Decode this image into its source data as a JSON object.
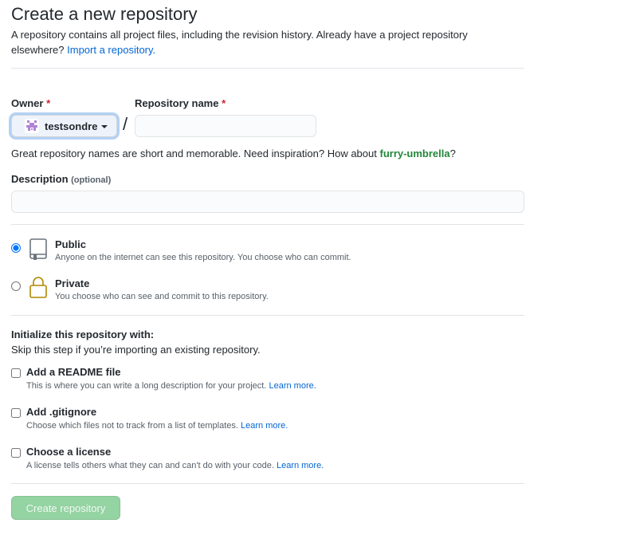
{
  "header": {
    "title": "Create a new repository",
    "subhead_text": "A repository contains all project files, including the revision history. Already have a project repository elsewhere?",
    "import_link": "Import a repository."
  },
  "owner": {
    "label": "Owner",
    "required_mark": "*",
    "selected": "testsondre"
  },
  "repo_name": {
    "label": "Repository name",
    "required_mark": "*",
    "value": "",
    "placeholder": "",
    "separator": "/"
  },
  "hint": {
    "prefix": "Great repository names are short and memorable. Need inspiration? How about",
    "suggestion": "furry-umbrella",
    "suffix": "?"
  },
  "description": {
    "label": "Description",
    "optional": "(optional)",
    "value": ""
  },
  "visibility": {
    "selected": "public",
    "options": [
      {
        "id": "public",
        "title": "Public",
        "desc": "Anyone on the internet can see this repository. You choose who can commit.",
        "icon": "repo-icon"
      },
      {
        "id": "private",
        "title": "Private",
        "desc": "You choose who can see and commit to this repository.",
        "icon": "lock-icon"
      }
    ]
  },
  "init": {
    "title": "Initialize this repository with:",
    "subtitle": "Skip this step if you’re importing an existing repository.",
    "options": [
      {
        "title": "Add a README file",
        "desc": "This is where you can write a long description for your project.",
        "link": "Learn more.",
        "checked": false
      },
      {
        "title": "Add .gitignore",
        "desc": "Choose which files not to track from a list of templates.",
        "link": "Learn more.",
        "checked": false
      },
      {
        "title": "Choose a license",
        "desc": "A license tells others what they can and can't do with your code.",
        "link": "Learn more.",
        "checked": false
      }
    ]
  },
  "submit": {
    "label": "Create repository",
    "disabled": true
  },
  "colors": {
    "link": "#0366d6",
    "required": "#cb2431",
    "suggestion": "#22863a",
    "button_disabled": "#94d3a2"
  }
}
